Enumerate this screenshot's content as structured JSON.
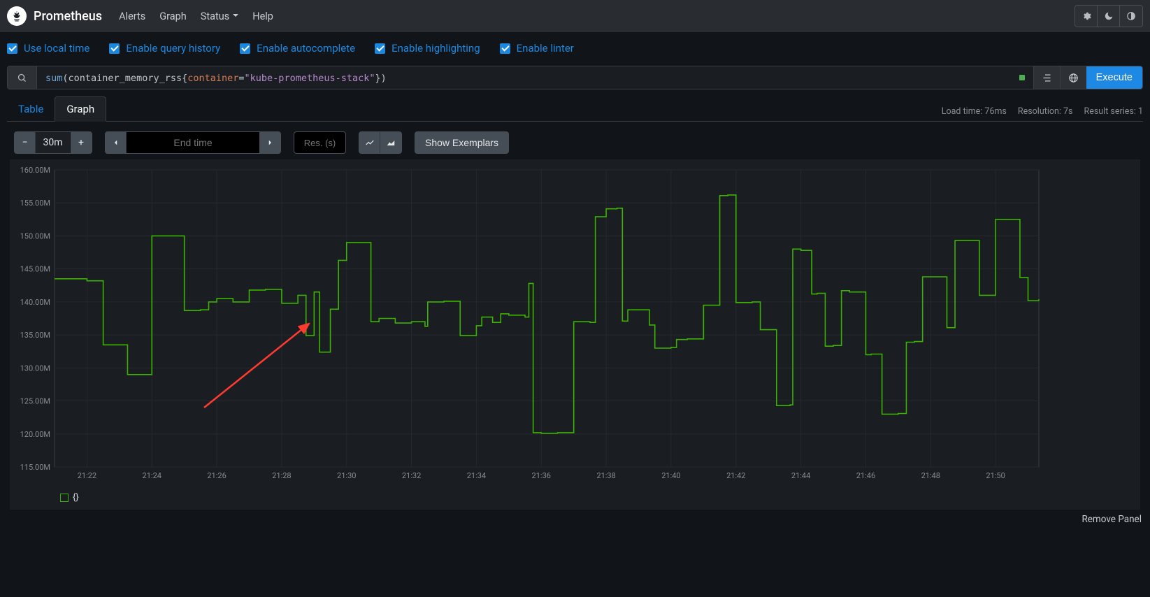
{
  "header": {
    "brand": "Prometheus",
    "nav": [
      "Alerts",
      "Graph",
      "Status",
      "Help"
    ],
    "status_has_dropdown": true
  },
  "options": [
    {
      "label": "Use local time",
      "checked": true
    },
    {
      "label": "Enable query history",
      "checked": true
    },
    {
      "label": "Enable autocomplete",
      "checked": true
    },
    {
      "label": "Enable highlighting",
      "checked": true
    },
    {
      "label": "Enable linter",
      "checked": true
    }
  ],
  "query": {
    "fn": "sum",
    "metric": "container_memory_rss",
    "label_key": "container",
    "label_value": "kube-prometheus-stack",
    "execute_label": "Execute"
  },
  "meta": {
    "load_time": "Load time: 76ms",
    "resolution": "Resolution: 7s",
    "result_series": "Result series: 1"
  },
  "tabs": {
    "table": "Table",
    "graph": "Graph"
  },
  "controls": {
    "range": "30m",
    "end_time_placeholder": "End time",
    "res_placeholder": "Res. (s)",
    "show_exemplars": "Show Exemplars"
  },
  "legend": {
    "label": "{}"
  },
  "footer": {
    "remove_panel": "Remove Panel"
  },
  "chart_data": {
    "type": "line",
    "title": "",
    "xlabel": "",
    "ylabel": "",
    "ylim": [
      115000000,
      160000000
    ],
    "y_ticks": [
      "115.00M",
      "120.00M",
      "125.00M",
      "130.00M",
      "135.00M",
      "140.00M",
      "145.00M",
      "150.00M",
      "155.00M",
      "160.00M"
    ],
    "x_ticks": [
      "21:22",
      "21:24",
      "21:26",
      "21:28",
      "21:30",
      "21:32",
      "21:34",
      "21:36",
      "21:38",
      "21:40",
      "21:42",
      "21:44",
      "21:46",
      "21:48",
      "21:50"
    ],
    "series": [
      {
        "name": "{}",
        "color": "#3cb300",
        "x": [
          "21:21:00",
          "21:21:30",
          "21:22:00",
          "21:22:30",
          "21:23:00",
          "21:23:15",
          "21:23:30",
          "21:24:00",
          "21:24:30",
          "21:25:00",
          "21:25:30",
          "21:25:45",
          "21:26:00",
          "21:26:30",
          "21:27:00",
          "21:27:10",
          "21:27:30",
          "21:28:00",
          "21:28:30",
          "21:28:45",
          "21:29:00",
          "21:29:10",
          "21:29:30",
          "21:29:45",
          "21:30:00",
          "21:30:30",
          "21:30:45",
          "21:31:00",
          "21:31:30",
          "21:32:00",
          "21:32:25",
          "21:32:30",
          "21:33:00",
          "21:33:30",
          "21:34:00",
          "21:34:10",
          "21:34:30",
          "21:34:45",
          "21:35:00",
          "21:35:30",
          "21:35:37",
          "21:35:45",
          "21:36:00",
          "21:36:30",
          "21:36:50",
          "21:37:00",
          "21:37:30",
          "21:37:40",
          "21:38:00",
          "21:38:20",
          "21:38:30",
          "21:38:40",
          "21:39:00",
          "21:39:20",
          "21:39:30",
          "21:40:00",
          "21:40:10",
          "21:40:30",
          "21:41:00",
          "21:41:30",
          "21:41:45",
          "21:42:00",
          "21:42:30",
          "21:42:45",
          "21:43:00",
          "21:43:15",
          "21:43:40",
          "21:43:45",
          "21:44:00",
          "21:44:20",
          "21:44:30",
          "21:44:45",
          "21:45:00",
          "21:45:15",
          "21:45:30",
          "21:46:00",
          "21:46:10",
          "21:46:30",
          "21:47:00",
          "21:47:15",
          "21:47:30",
          "21:47:45",
          "21:48:00",
          "21:48:30",
          "21:48:45",
          "21:49:00",
          "21:49:30",
          "21:49:40",
          "21:50:00",
          "21:50:30",
          "21:50:45",
          "21:51:00",
          "21:51:20"
        ],
        "values": [
          143500000,
          143500000,
          143200000,
          133500000,
          133500000,
          129000000,
          129000000,
          150000000,
          150000000,
          138700000,
          138800000,
          140000000,
          140500000,
          140000000,
          141800000,
          141800000,
          141900000,
          139800000,
          141000000,
          134900000,
          141500000,
          132400000,
          138900000,
          146300000,
          149000000,
          149000000,
          137000000,
          137500000,
          136800000,
          137000000,
          136300000,
          140000000,
          140100000,
          134900000,
          136400000,
          137700000,
          136900000,
          138200000,
          138000000,
          137700000,
          142800000,
          120200000,
          120100000,
          120200000,
          120200000,
          137000000,
          136900000,
          152900000,
          154100000,
          154200000,
          137100000,
          138800000,
          138800000,
          136500000,
          133000000,
          133100000,
          134300000,
          134400000,
          139500000,
          156100000,
          156200000,
          139900000,
          140000000,
          135800000,
          135800000,
          124300000,
          124400000,
          148000000,
          147800000,
          141200000,
          141300000,
          133300000,
          133400000,
          141700000,
          141500000,
          132000000,
          132100000,
          123000000,
          123100000,
          133900000,
          134000000,
          143800000,
          143800000,
          136100000,
          149300000,
          149300000,
          141000000,
          141000000,
          152500000,
          152500000,
          143700000,
          140200000,
          140400000
        ]
      }
    ]
  },
  "annotation": {
    "present": true,
    "shape": "arrow",
    "color": "#ff3b30",
    "target_x": "21:29",
    "target_y_approx": 137000000
  }
}
